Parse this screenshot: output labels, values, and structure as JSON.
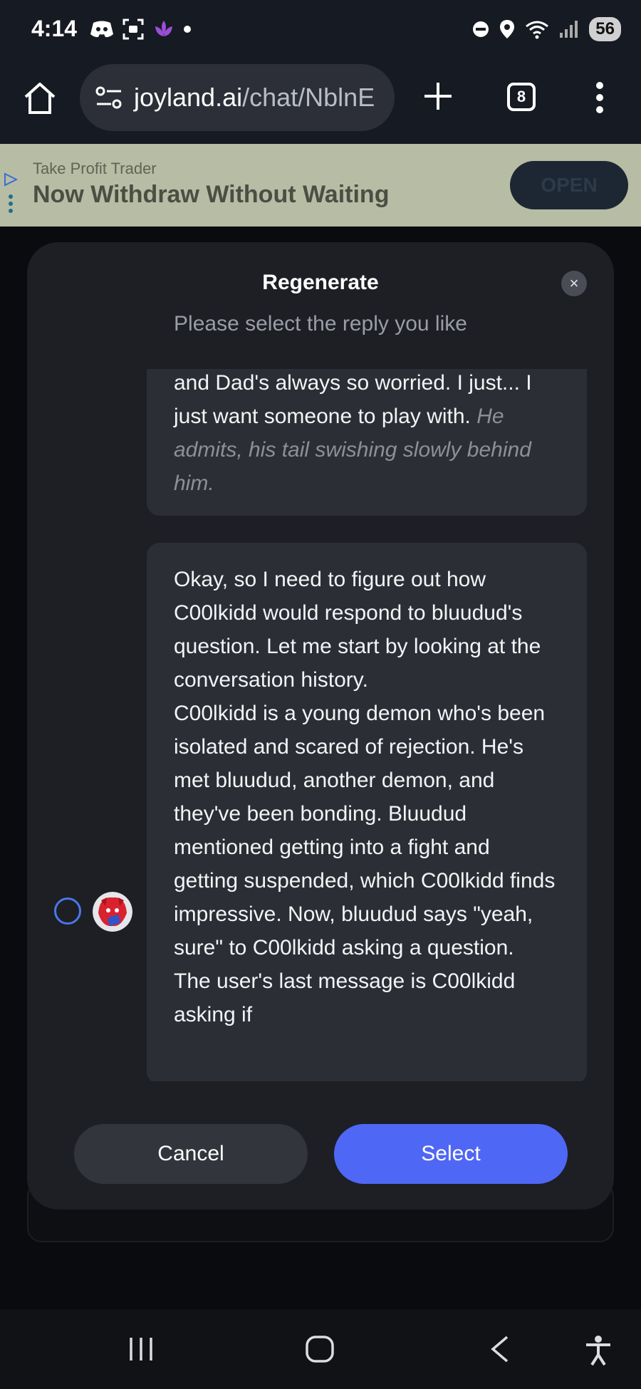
{
  "status_bar": {
    "time": "4:14",
    "battery": "56",
    "icons": [
      "discord-icon",
      "screenshot-icon",
      "lotus-icon",
      "dot-icon",
      "dnd-icon",
      "location-icon",
      "wifi-icon",
      "signal-icon",
      "battery-icon"
    ]
  },
  "browser": {
    "url_domain": "joyland.ai",
    "url_path": "/chat/NblnE",
    "tab_count": "8"
  },
  "ad": {
    "advertiser": "Take Profit Trader",
    "headline": "Now Withdraw Without Waiting",
    "cta": "OPEN"
  },
  "modal": {
    "title": "Regenerate",
    "subtitle": "Please select the reply you like",
    "close_symbol": "×",
    "reply1": {
      "text": "and Dad's always so worried. I just... I just want someone to play with.",
      "action": "He admits, his tail swishing slowly behind him."
    },
    "reply2": {
      "text": "Okay, so I need to figure out how C00lkidd would respond to bluudud's question. Let me start by looking at the conversation history.",
      "text2": "C00lkidd is a young demon who's been isolated and scared of rejection. He's met bluudud, another demon, and they've been bonding. Bluudud mentioned getting into a fight and getting suspended, which C00lkidd finds impressive. Now, bluudud says \"yeah, sure\" to C00lkidd asking a question.",
      "text3": "The user's last message is C00lkidd asking if"
    },
    "cancel_label": "Cancel",
    "select_label": "Select"
  },
  "colors": {
    "accent": "#4f67f5",
    "modal_bg": "#1d1f25",
    "card_bg": "#2c2e35"
  }
}
